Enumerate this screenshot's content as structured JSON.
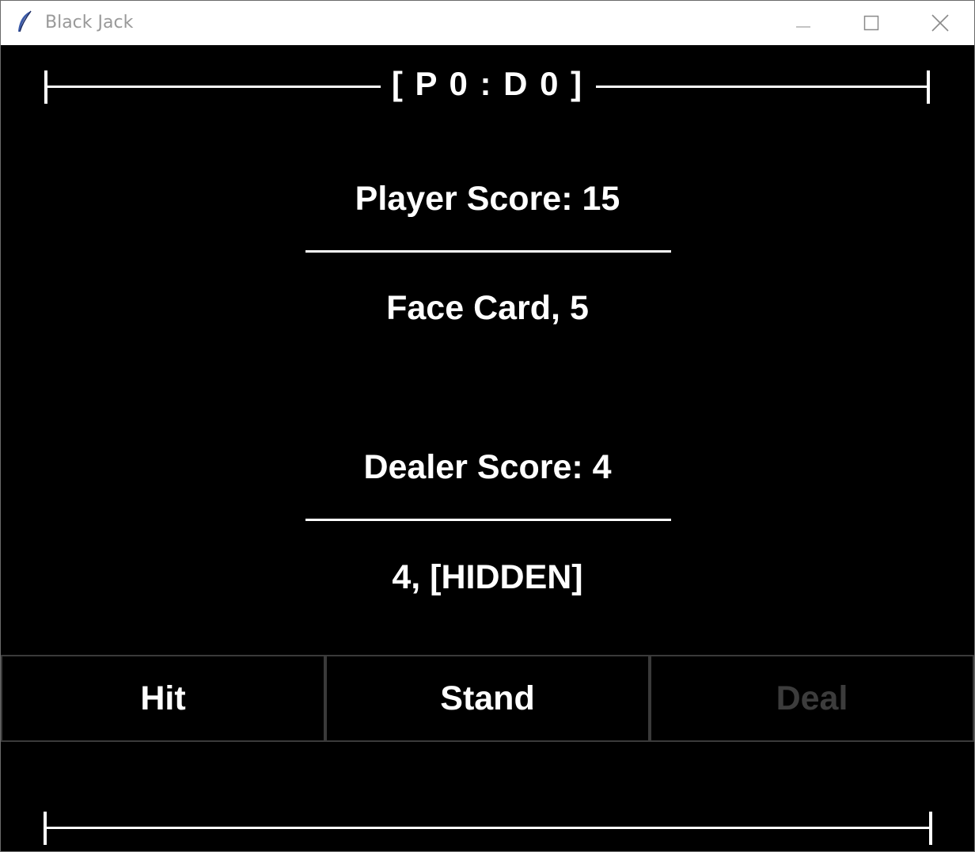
{
  "window": {
    "title": "Black Jack"
  },
  "scoreboard": {
    "text": "[ P 0 : D 0 ]"
  },
  "player": {
    "score_text": "Player Score: 15",
    "cards_text": "Face Card, 5"
  },
  "dealer": {
    "score_text": "Dealer Score: 4",
    "cards_text": "4, [HIDDEN]"
  },
  "buttons": {
    "hit": "Hit",
    "stand": "Stand",
    "deal": "Deal"
  },
  "colors": {
    "background": "#000000",
    "foreground": "#ffffff",
    "disabled_text": "#3c3c3c"
  },
  "icons": {
    "app": "feather-icon",
    "minimize": "minimize-icon",
    "maximize": "maximize-icon",
    "close": "close-icon"
  }
}
